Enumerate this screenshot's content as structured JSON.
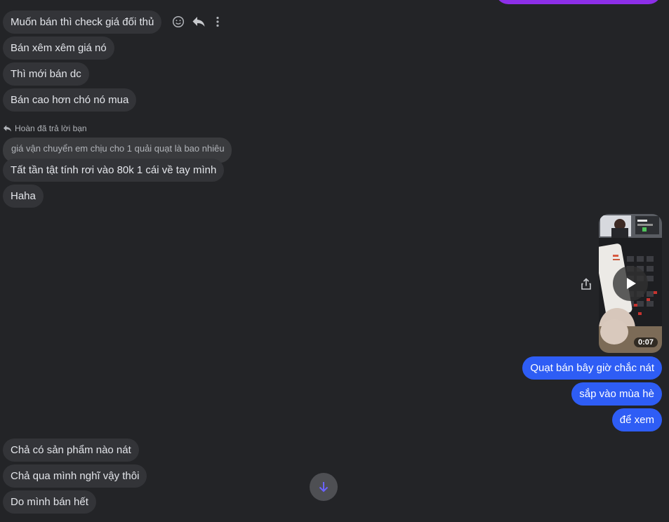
{
  "messages_incoming_top": [
    "Muốn bán thì check giá đối thủ",
    "Bán xêm xêm giá nó",
    "Thì mới bán dc",
    "Bán cao hơn chó nó mua"
  ],
  "reply": {
    "note": "Hoàn đã trả lời bạn",
    "quoted_text": "giá vận chuyển em chịu cho 1 quải quạt là bao nhiêu",
    "message": "Tất tần tật tính rơi vào 80k 1 cái về tay mình"
  },
  "message_haha": "Haha",
  "video": {
    "duration": "0:07"
  },
  "messages_outgoing": [
    "Quạt bán bây giờ chắc nát",
    "sắp vào mùa hè",
    "để xem"
  ],
  "messages_incoming_bottom": [
    "Chả có sản phẩm nào nát",
    "Chả qua mình nghĩ vậy thôi",
    "Do mình bán hết"
  ],
  "colors": {
    "background": "#232427",
    "incoming_bubble": "#333438",
    "outgoing_bubble": "#2e5df5",
    "accent_purple": "#8d2fe8"
  },
  "icons": [
    "smile-icon",
    "reply-icon",
    "more-options-icon",
    "share-icon",
    "play-icon",
    "arrow-down-icon"
  ]
}
